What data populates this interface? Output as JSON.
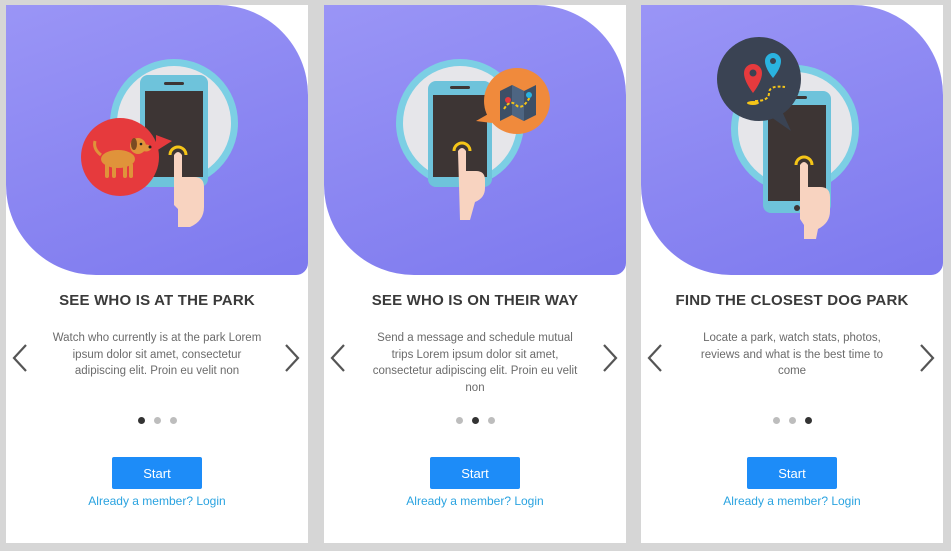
{
  "colors": {
    "hero_gradient_start": "#9a95f6",
    "hero_gradient_end": "#7d79ee",
    "button": "#1d8cf8",
    "link": "#2aa3e0",
    "dot_active": "#333333",
    "dot_inactive": "#bdbdbd"
  },
  "slides": [
    {
      "illustration": "dog-badge-icon",
      "title": "SEE WHO IS AT THE PARK",
      "description": "Watch who currently is at the park Lorem ipsum dolor sit amet, consectetur adipiscing elit. Proin eu velit non",
      "active_dot": 0,
      "start_label": "Start",
      "login_label": "Already a member? Login"
    },
    {
      "illustration": "map-badge-icon",
      "title": "SEE WHO IS ON THEIR WAY",
      "description": "Send a message and schedule mutual trips Lorem ipsum dolor sit amet, consectetur adipiscing elit. Proin eu velit non",
      "active_dot": 1,
      "start_label": "Start",
      "login_label": "Already a member? Login"
    },
    {
      "illustration": "route-pins-badge-icon",
      "title": "FIND THE CLOSEST DOG PARK",
      "description": "Locate a park, watch stats, photos, reviews and what is the best time to come",
      "active_dot": 2,
      "start_label": "Start",
      "login_label": "Already a member? Login"
    }
  ]
}
